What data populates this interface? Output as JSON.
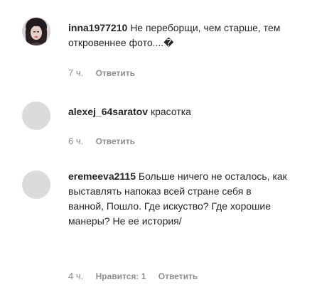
{
  "comments": [
    {
      "username": "inna1977210",
      "text": "Не переборщи, чем старше, тем откровеннее фото....�",
      "time": "7 ч.",
      "reply_label": "Ответить",
      "avatar": "photo"
    },
    {
      "username": "alexej_64saratov",
      "text": "красотка",
      "time": "6 ч.",
      "reply_label": "Ответить",
      "avatar": "placeholder"
    },
    {
      "username": "eremeeva2115",
      "text": "Больше ничего не осталось, как выставлять напоказ всей стране себя в ванной, Пошло. Где искуство? Где хорошие манеры? Не ее история/",
      "time": "4 ч.",
      "likes_label": "Нравится: 1",
      "reply_label": "Ответить",
      "avatar": "placeholder"
    }
  ]
}
